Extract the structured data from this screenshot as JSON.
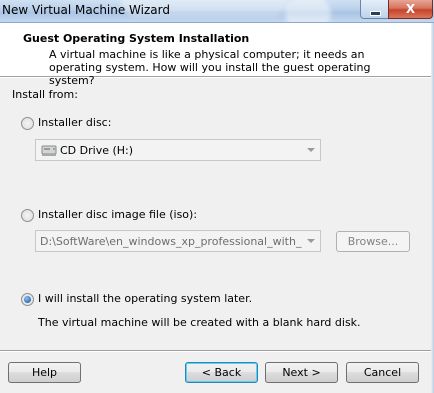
{
  "window": {
    "title": "New Virtual Machine Wizard",
    "close_glyph": "X"
  },
  "header": {
    "title": "Guest Operating System Installation",
    "subtitle": "A virtual machine is like a physical computer; it needs an operating system. How will you install the guest operating system?"
  },
  "install_from": {
    "label": "Install from:",
    "options": [
      {
        "label": "Installer disc:",
        "selected": false
      },
      {
        "label": "Installer disc image file (iso):",
        "selected": false
      },
      {
        "label": "I will install the operating system later.",
        "selected": true
      }
    ],
    "disc_combo_value": "CD Drive (H:)",
    "iso_combo_value": "D:\\SoftWare\\en_windows_xp_professional_with_servi",
    "browse_label": "Browse...",
    "later_note": "The virtual machine will be created with a blank hard disk."
  },
  "footer": {
    "help_label": "Help",
    "back_label": "< Back",
    "next_label": "Next >",
    "cancel_label": "Cancel"
  },
  "icons": {
    "drive": "cd-drive-icon",
    "radio_selected_color": "#2a6fb5"
  }
}
